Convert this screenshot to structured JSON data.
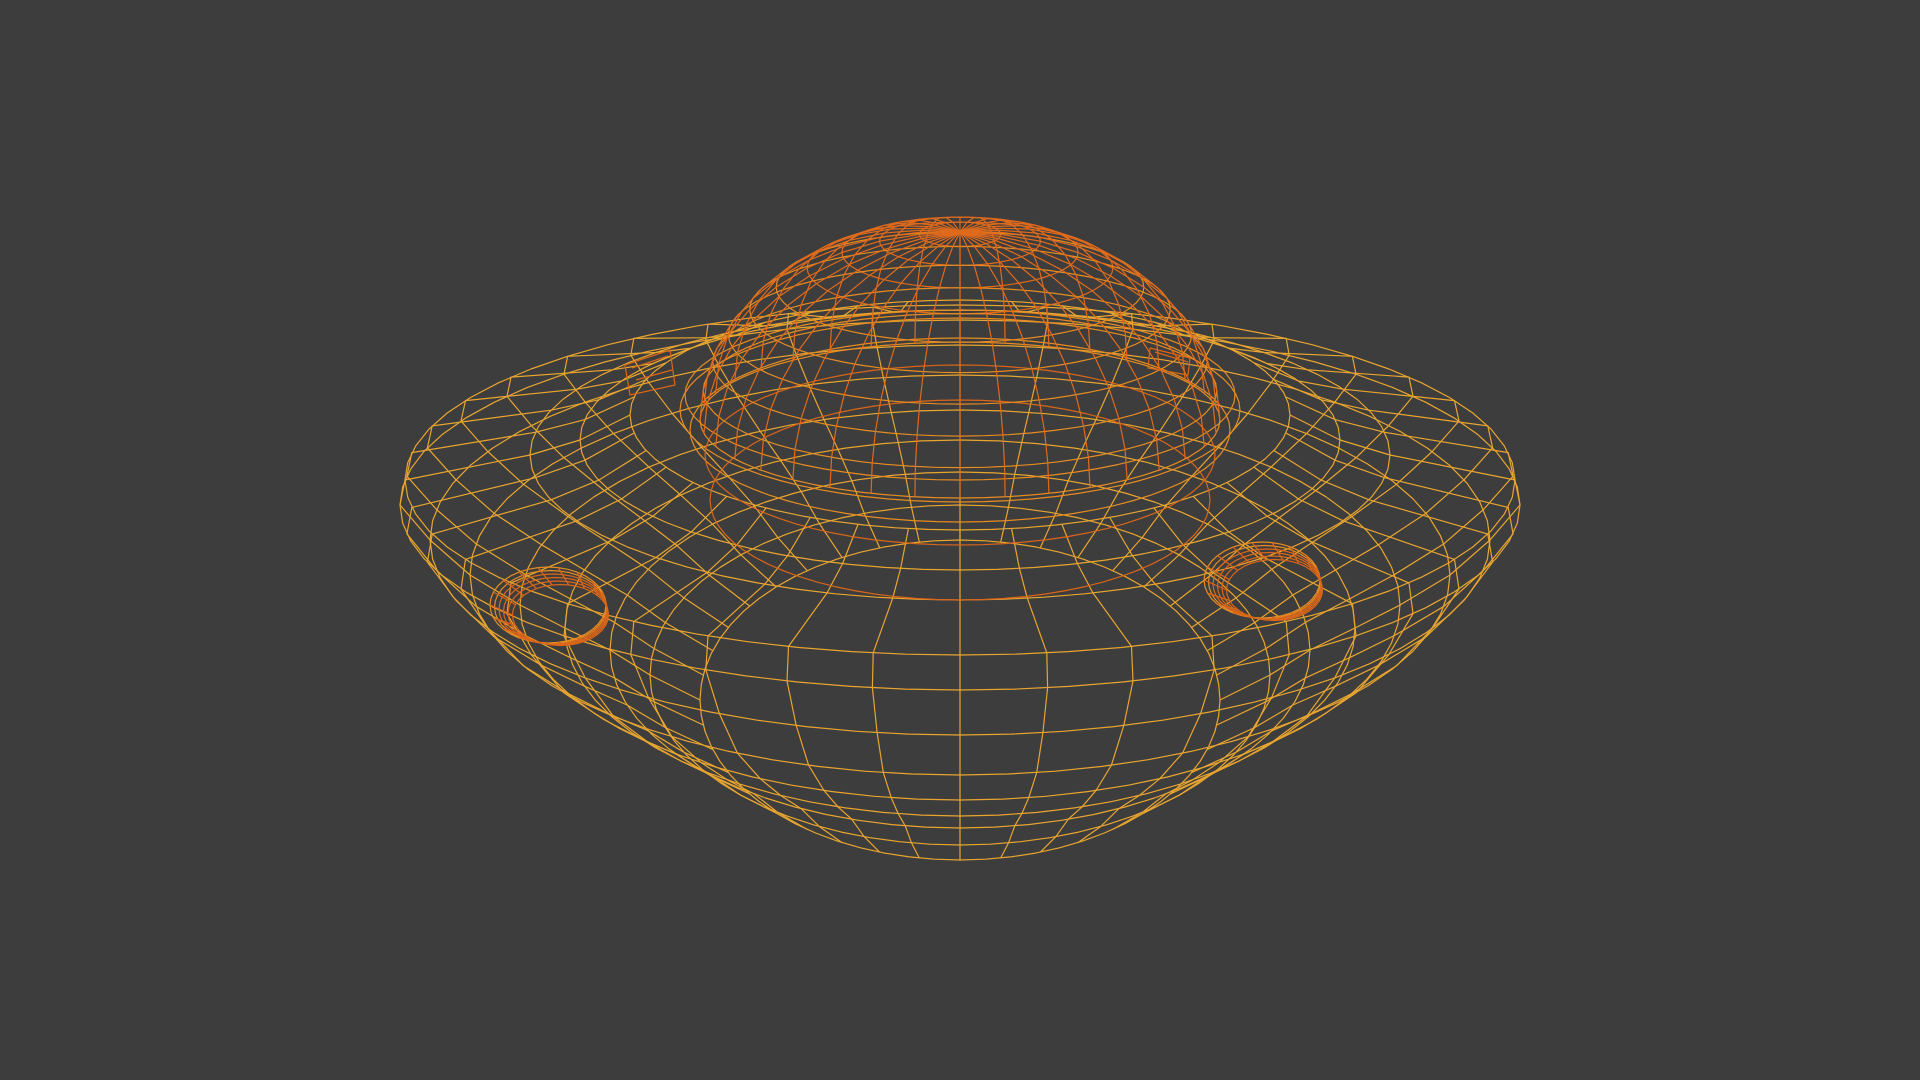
{
  "viewport": {
    "background_color": "#3d3d3d",
    "display_mode": "wireframe",
    "object": "saucer-model"
  },
  "colors": {
    "wire_outer": "#e8a530",
    "wire_mid": "#e58c22",
    "wire_inner": "#d9661a",
    "wire_dome_top": "#e06a1c"
  }
}
